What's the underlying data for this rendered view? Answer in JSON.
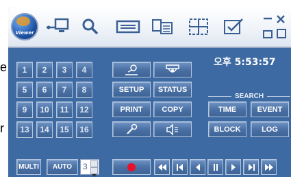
{
  "edge_text": {
    "e": "e",
    "r": "r"
  },
  "toolbar": {
    "logo_label": "Viewer",
    "icons": [
      "network-connect-icon",
      "search-icon",
      "dvr-device-icon",
      "file-export-icon",
      "screen-grid-icon",
      "edit-check-icon",
      "window-controls-icon"
    ]
  },
  "clock": "오후 5:53:57",
  "channels": [
    "1",
    "2",
    "3",
    "4",
    "5",
    "6",
    "7",
    "8",
    "9",
    "10",
    "11",
    "12",
    "13",
    "14",
    "15",
    "16"
  ],
  "view": {
    "multi": "MULTI",
    "auto": "AUTO",
    "auto_value": "3"
  },
  "functions": {
    "setup": "SETUP",
    "status": "STATUS",
    "print": "PRINT",
    "copy": "COPY"
  },
  "search": {
    "label": "SEARCH",
    "time": "TIME",
    "event": "EVENT",
    "block": "BLOCK",
    "log": "LOG"
  },
  "playback": {
    "record_color": "#e8102a",
    "icons": [
      "record-icon",
      "fast-rewind-icon",
      "step-back-icon",
      "play-reverse-icon",
      "pause-icon",
      "play-icon",
      "step-forward-icon",
      "fast-forward-icon"
    ]
  },
  "colors": {
    "panel": "#3d6aa2",
    "button": "#4b71a5"
  }
}
